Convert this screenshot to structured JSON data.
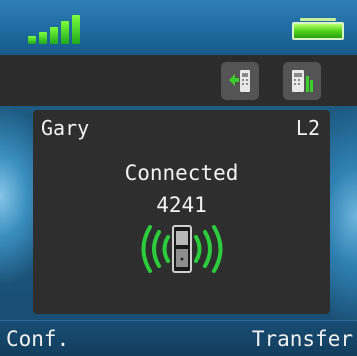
{
  "status": {
    "signal_icon": "signal-strength-icon",
    "battery_icon": "battery-full-icon",
    "signal_bars": 5,
    "battery_level": 1.0,
    "accent": "#3ccc2c"
  },
  "toolbar": {
    "buttons": [
      {
        "icon": "call-transfer-icon"
      },
      {
        "icon": "phonebook-icon"
      }
    ]
  },
  "call": {
    "name": "Gary",
    "line": "L2",
    "status": "Connected",
    "number": "4241",
    "icon": "handset-ringing-icon"
  },
  "softkeys": {
    "left": "Conf.",
    "right": "Transfer"
  }
}
